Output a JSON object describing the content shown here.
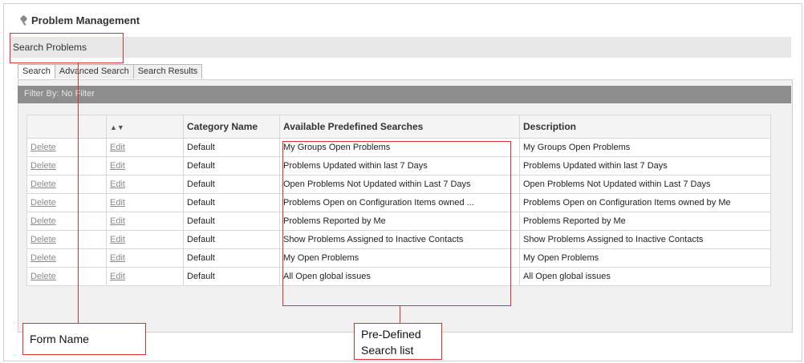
{
  "header": {
    "title": "Problem Management",
    "icon": "pin-icon"
  },
  "section": {
    "label": "Search Problems"
  },
  "tabs": [
    {
      "label": "Search",
      "active": true
    },
    {
      "label": "Advanced Search",
      "active": false
    },
    {
      "label": "Search Results",
      "active": false
    }
  ],
  "filter": {
    "text": "Filter By: No Filter"
  },
  "table": {
    "columns": [
      "",
      "",
      "Category Name",
      "Available Predefined Searches",
      "Description"
    ],
    "rows": [
      {
        "delete": "Delete",
        "edit": "Edit",
        "category": "Default",
        "search": "My Groups Open Problems",
        "description": "My Groups Open Problems"
      },
      {
        "delete": "Delete",
        "edit": "Edit",
        "category": "Default",
        "search": "Problems Updated within last 7 Days",
        "description": "Problems Updated within last 7 Days"
      },
      {
        "delete": "Delete",
        "edit": "Edit",
        "category": "Default",
        "search": "Open Problems Not Updated within Last 7 Days",
        "description": "Open Problems Not Updated within Last 7 Days"
      },
      {
        "delete": "Delete",
        "edit": "Edit",
        "category": "Default",
        "search": "Problems Open on Configuration Items owned ...",
        "description": "Problems Open on Configuration Items owned by Me"
      },
      {
        "delete": "Delete",
        "edit": "Edit",
        "category": "Default",
        "search": "Problems Reported by Me",
        "description": "Problems Reported by Me"
      },
      {
        "delete": "Delete",
        "edit": "Edit",
        "category": "Default",
        "search": "Show Problems Assigned to Inactive Contacts",
        "description": "Show Problems Assigned to Inactive Contacts"
      },
      {
        "delete": "Delete",
        "edit": "Edit",
        "category": "Default",
        "search": "My Open Problems",
        "description": "My Open Problems"
      },
      {
        "delete": "Delete",
        "edit": "Edit",
        "category": "Default",
        "search": "All Open global issues",
        "description": "All Open global issues"
      }
    ]
  },
  "annotations": {
    "form_name": "Form Name",
    "predefined_line1": "Pre-Defined",
    "predefined_line2": "Search list",
    "color": "#e03030"
  }
}
